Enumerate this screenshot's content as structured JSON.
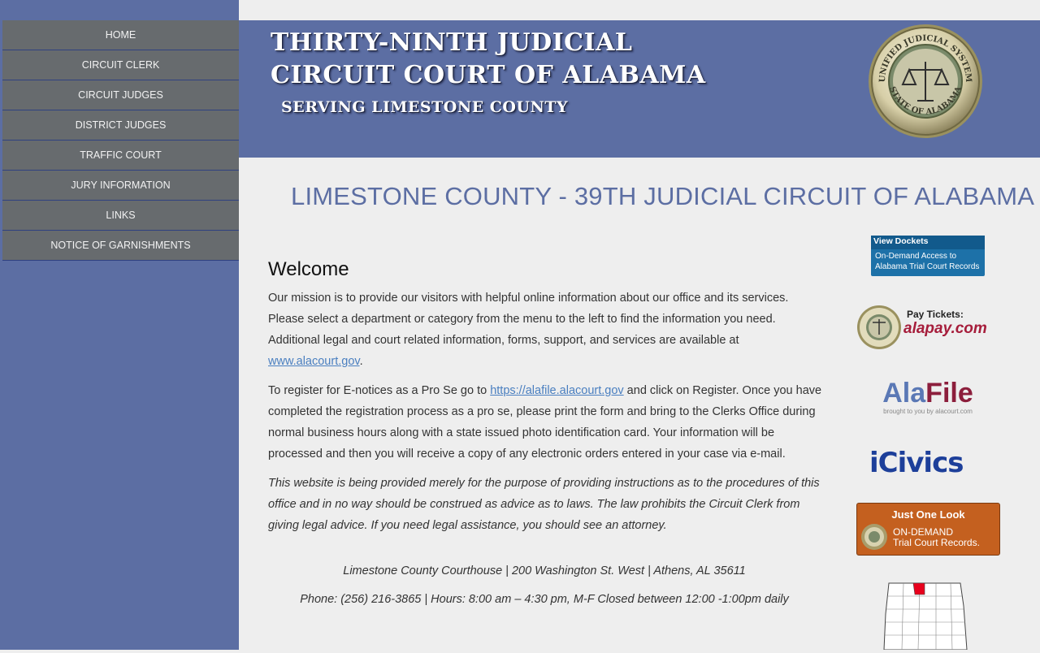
{
  "nav": {
    "items": [
      {
        "label": "HOME"
      },
      {
        "label": "CIRCUIT CLERK"
      },
      {
        "label": "CIRCUIT JUDGES"
      },
      {
        "label": "DISTRICT JUDGES"
      },
      {
        "label": "TRAFFIC COURT"
      },
      {
        "label": "JURY INFORMATION"
      },
      {
        "label": "LINKS"
      },
      {
        "label": "NOTICE OF GARNISHMENTS"
      }
    ]
  },
  "banner": {
    "line1": "THIRTY-NINTH JUDICIAL",
    "line2": "CIRCUIT COURT OF ALABAMA",
    "line3": "SERVING LIMESTONE COUNTY",
    "seal": {
      "top_text": "UNIFIED JUDICIAL SYSTEM",
      "bottom_text": "STATE OF ALABAMA"
    }
  },
  "main": {
    "heading": "LIMESTONE COUNTY - 39TH JUDICIAL CIRCUIT OF ALABAMA",
    "welcome_title": "Welcome",
    "p1_text": "Our mission is to provide our visitors with helpful online information about our office and its services. Please select a department or category from the menu to the left to find the information you need. Additional legal and court related information, forms, support, and services are available at ",
    "p1_link": "www.alacourt.gov",
    "p1_end": ".",
    "p2_start": "To register for E-notices as a Pro Se go to ",
    "p2_link": "https://alafile.alacourt.gov",
    "p2_end": " and click on Register. Once you have completed the registration process as a pro se, please print the form and bring to the Clerks Office during normal business hours along with a state issued photo identification card. Your information will be processed and then you will receive a copy of any electronic orders entered in your case via e-mail.",
    "disclaimer": "This website is being provided merely for the purpose of providing instructions as to the procedures of this office and in no way should be construed as advice as to laws. The law prohibits the Circuit Clerk from giving legal advice. If you need legal assistance, you should see an attorney.",
    "address": "Limestone County Courthouse | 200 Washington St. West | Athens, AL 35611",
    "phone_hours": "Phone: (256) 216-3865 | Hours: 8:00 am – 4:30 pm, M-F Closed between 12:00 -1:00pm daily"
  },
  "rail": {
    "dockets_title": "View Dockets",
    "dockets_sub": "On-Demand Access to Alabama Trial Court Records",
    "pay_label": "Pay Tickets:",
    "pay_site": "alapay.com",
    "alafile_a": "Ala",
    "alafile_b": "File",
    "alafile_sub": "brought to you by alacourt.com",
    "icivics": "iCivics",
    "jol_title": "Just One Look",
    "jol_sub1": "ON-DEMAND",
    "jol_sub2": "Trial Court Records."
  },
  "colors": {
    "primary": "#5c6ea3",
    "nav_bg": "#676b6e",
    "link": "#4a7fc0"
  }
}
